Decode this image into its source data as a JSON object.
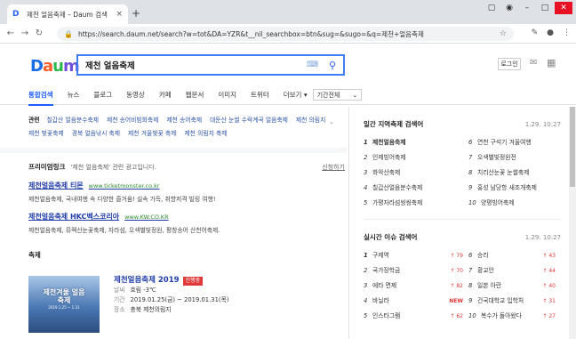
{
  "browser": {
    "tab_title": "제천 얼음축제 – Daum 검색",
    "tab_favicon": "D",
    "url": "https://search.daum.net/search?w=tot&DA=YZR&t__nil_searchbox=btn&sug=&sugo=&q=제천+얼음축제",
    "back": "←",
    "forward": "→",
    "reload": "↻"
  },
  "header": {
    "logo": [
      "D",
      "a",
      "u",
      "m"
    ],
    "query": "제천 얼음축제",
    "login": "로그인"
  },
  "tabs": [
    "통합검색",
    "뉴스",
    "블로그",
    "동영상",
    "카페",
    "웹문서",
    "이미지",
    "트위터",
    "더보기 ▾"
  ],
  "period": "기간전체",
  "related": {
    "label": "관련",
    "items": [
      "칠갑산 얼음분수축제",
      "제천 송어비빔회축제",
      "제천 송어축제",
      "대둔산 눈썰 수락계곡 얼음축제",
      "제천 의림지",
      "제천 벚꽃축제",
      "경북 얼음낚시 축제",
      "제천 겨울벚꽃 축제",
      "제천 의림지 축제"
    ]
  },
  "powerlink": {
    "title": "프리미엄링크",
    "desc": "'제천 얼음축제' 관련 광고입니다.",
    "apply": "신청하기",
    "ads": [
      {
        "title": "제천얼음축제 티몬",
        "url": "www.ticketmonster.co.kr",
        "desc": "제천얼음축제, 국내여행 속 다양한 즐거움! 실속 가득, 취향저격 빌링 여행!"
      },
      {
        "title": "제천얼음축제 HKC벡스코리아",
        "url": "www.KW.CO.KR",
        "desc": "제천얼음축제, 뮤렉산눈꽃축제, 자라섬, 오색별빛정원, 평창송어 산천어축제."
      }
    ]
  },
  "festival": {
    "label": "축제",
    "name": "제천얼음축제 2019",
    "status": "진행중",
    "poster_title": "제천겨울 얼음축제",
    "poster_sub": "2019.1.25 ~ 1.31",
    "weather_k": "날씨",
    "weather_v": "흐림 -3℃",
    "period_k": "기간",
    "period_v": "2019.01.25(금) ~ 2019.01.31(목)",
    "place_k": "장소",
    "place_v": "충북 제천의림지"
  },
  "realtime_area": {
    "title": "일간 지역축제 검색어",
    "time": "1.29. 10:27",
    "items": [
      "제천얼음축제",
      "인제빙어축제",
      "화악산축제",
      "칠갑산얼음분수축제",
      "가평자라섬씽씽축제",
      "연천 구석기 겨울여행",
      "오색별빛정원전",
      "치리산눈꽃 눈썰축제",
      "홍성 남당항 새조개축제",
      "양평빙어축제"
    ]
  },
  "realtime_issue": {
    "title": "실시간 이슈 검색어",
    "time": "1.29. 10:27",
    "items": [
      {
        "w": "구제역",
        "t": "↑ 79"
      },
      {
        "w": "국가장학금",
        "t": "↑ 70"
      },
      {
        "w": "에타 면제",
        "t": "↑ 82"
      },
      {
        "w": "바닐라",
        "t": "NEW"
      },
      {
        "w": "인스타그램",
        "t": "↑ 62"
      },
      {
        "w": "승리",
        "t": "↑ 43"
      },
      {
        "w": "황교안",
        "t": "↑ 44"
      },
      {
        "w": "일본 아란",
        "t": "↑ 40"
      },
      {
        "w": "건국대학교 입학처",
        "t": "↑ 31"
      },
      {
        "w": "복수가 돌아왔다",
        "t": "↑ 27"
      }
    ]
  }
}
